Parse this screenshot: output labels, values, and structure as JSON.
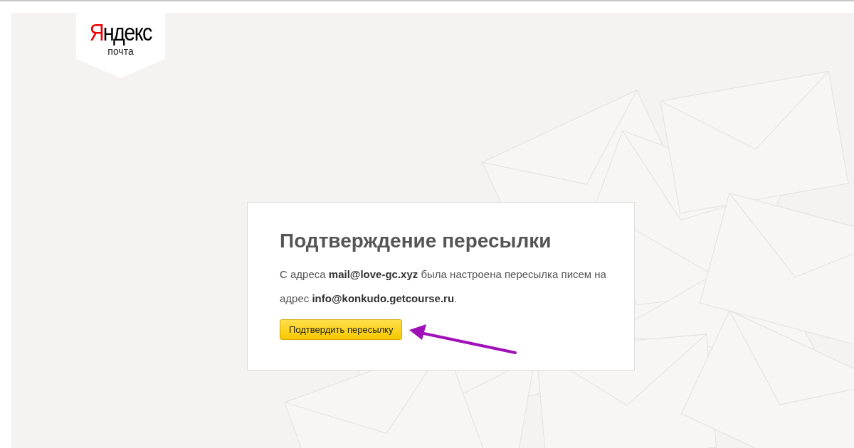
{
  "logo": {
    "initial": "Я",
    "rest": "ндекс",
    "service": "почта"
  },
  "dialog": {
    "title": "Подтверждение пересылки",
    "message": "С адреса **mail@love-gc.xyz** была настроена пересылка писем на адрес **info@konkudo.getcourse.ru**.",
    "button": "Подтвердить пересылку"
  }
}
